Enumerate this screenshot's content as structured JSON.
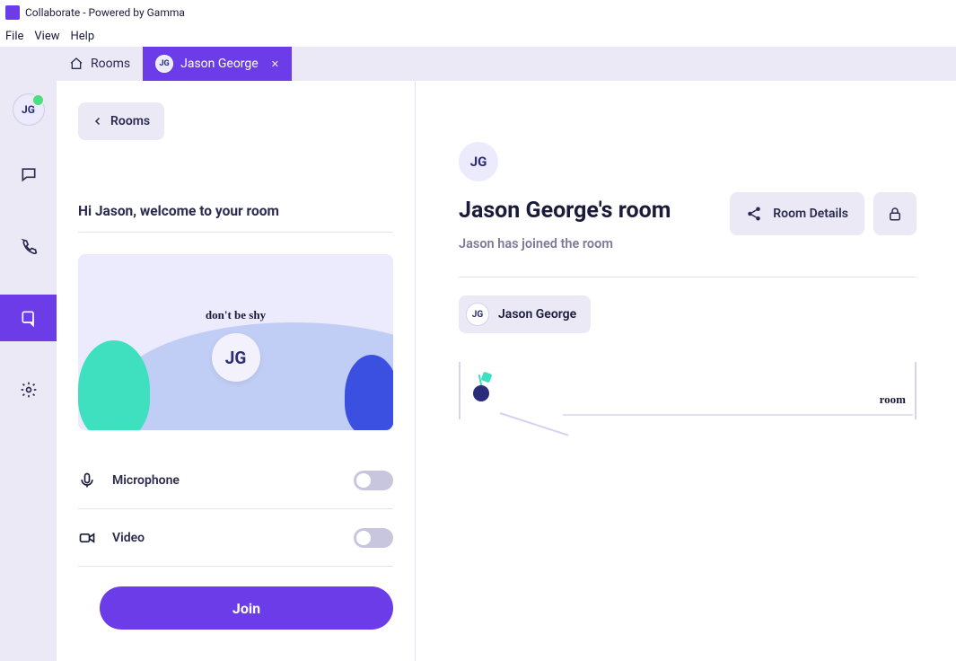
{
  "window": {
    "title": "Collaborate - Powered by Gamma"
  },
  "menu": {
    "file": "File",
    "view": "View",
    "help": "Help"
  },
  "tabs": {
    "rooms": "Rooms",
    "active_label": "Jason George",
    "active_initials": "JG"
  },
  "sidebar": {
    "user_initials": "JG"
  },
  "left_panel": {
    "back": "Rooms",
    "welcome": "Hi Jason, welcome to your room",
    "shy": "don't be shy",
    "preview_initials": "JG",
    "mic_label": "Microphone",
    "video_label": "Video",
    "join": "Join"
  },
  "right_panel": {
    "avatar_initials": "JG",
    "title": "Jason George's room",
    "subtitle": "Jason has joined the room",
    "details_btn": "Room Details",
    "participant": {
      "initials": "JG",
      "name": "Jason George"
    },
    "canvas_word": "room"
  }
}
